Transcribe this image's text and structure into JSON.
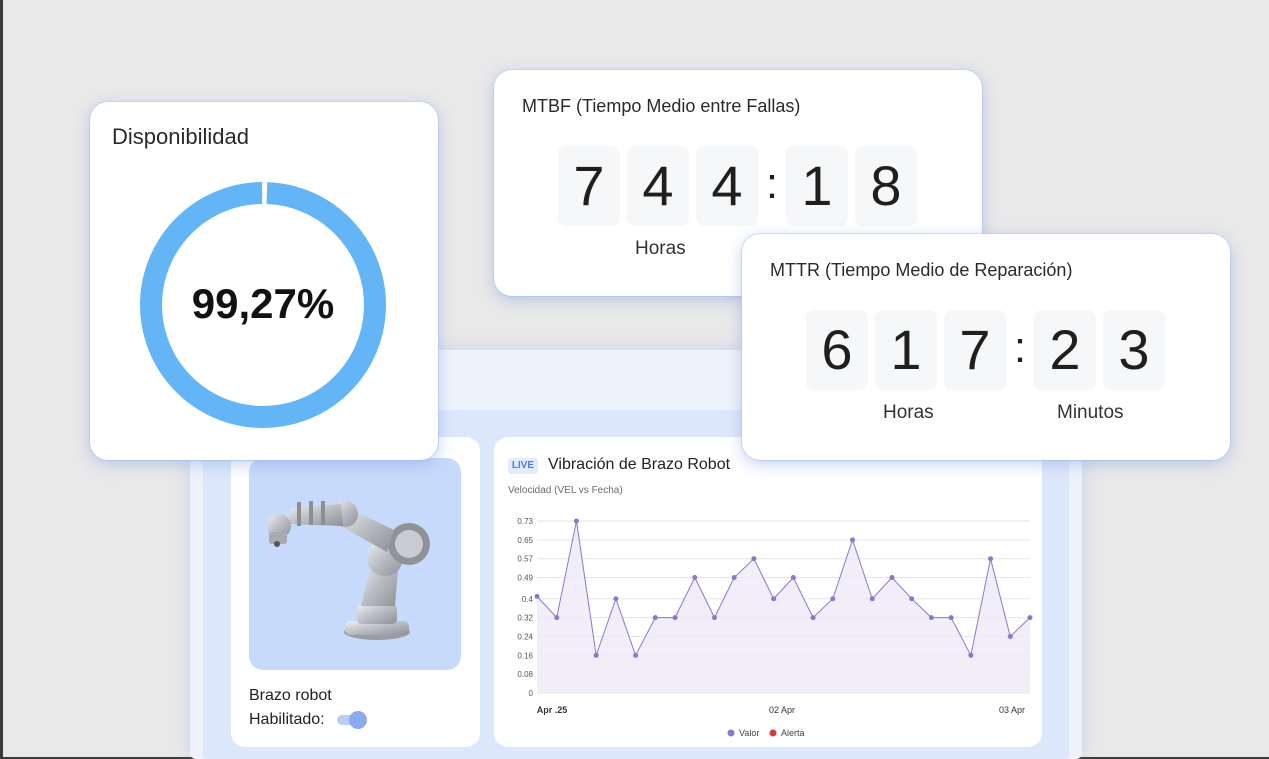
{
  "availability": {
    "title": "Disponibilidad",
    "value_label": "99,27%",
    "percent": 99.27,
    "ring_color": "#64b5f6"
  },
  "mtbf": {
    "title": "MTBF (Tiempo Medio entre Fallas)",
    "hours_digits": [
      "7",
      "4",
      "4"
    ],
    "minutes_digits": [
      "1",
      "8"
    ],
    "separator": ":",
    "hours_label": "Horas"
  },
  "mttr": {
    "title": "MTTR (Tiempo Medio de Reparación)",
    "hours_digits": [
      "6",
      "1",
      "7"
    ],
    "minutes_digits": [
      "2",
      "3"
    ],
    "separator": ":",
    "hours_label": "Horas",
    "minutes_label": "Minutos"
  },
  "robot": {
    "name": "Brazo robot",
    "enabled_label": "Habilitado:",
    "enabled": true
  },
  "chart_panel": {
    "live_badge": "LIVE",
    "title": "Vibración de Brazo Robot",
    "subtitle": "Velocidad (VEL vs Fecha)"
  },
  "chart_data": {
    "type": "line",
    "ylim": [
      0,
      0.73
    ],
    "y_ticks": [
      "0.73",
      "0.65",
      "0.57",
      "0.49",
      "0.4",
      "0.32",
      "0.24",
      "0.16",
      "0.08",
      "0"
    ],
    "x_ticks": [
      "Apr .25",
      "02 Apr",
      "03 Apr"
    ],
    "series": [
      {
        "name": "Valor",
        "color": "#8b78c8",
        "values": [
          0.41,
          0.32,
          0.73,
          0.16,
          0.4,
          0.16,
          0.32,
          0.32,
          0.49,
          0.32,
          0.49,
          0.57,
          0.4,
          0.49,
          0.32,
          0.4,
          0.65,
          0.4,
          0.49,
          0.4,
          0.32,
          0.32,
          0.16,
          0.57,
          0.24,
          0.32
        ]
      }
    ],
    "legend": [
      {
        "label": "Valor",
        "color": "#8b78c8"
      },
      {
        "label": "Alerta",
        "color": "#d93a3a"
      }
    ],
    "grid": true,
    "legend_position": "bottom"
  }
}
